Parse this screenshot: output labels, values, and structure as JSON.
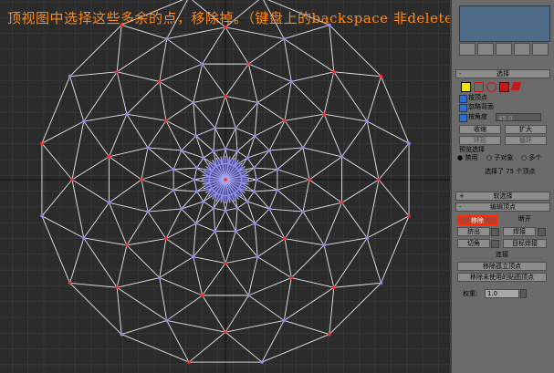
{
  "instruction": "顶视图中选择这些多余的点，移除掉。（键盘上的backspace 非delete）",
  "panel": {
    "selection_rollout": "选择",
    "sub_objects": [
      "顶点",
      "边",
      "边界",
      "多边形",
      "元素"
    ],
    "by_vertex": "按顶点",
    "ignore_backfacing": "忽略背面",
    "by_angle": "按角度",
    "by_angle_value": "45.0",
    "shrink": "收缩",
    "grow": "扩大",
    "ring": "环形",
    "loop": "循环",
    "preview_selection": "预览选择",
    "preview_options": [
      "禁用",
      "子对象",
      "多个"
    ],
    "selection_status": "选择了 75 个顶点",
    "soft_selection_rollout": "软选择",
    "edit_vertices_rollout": "编辑顶点",
    "remove": "移除",
    "break": "断开",
    "extrude": "挤出",
    "weld": "焊接",
    "chamfer": "切角",
    "target_weld": "目标焊接",
    "connect": "连接",
    "remove_isolated": "移除孤立顶点",
    "remove_unused_map": "移除未使用的贴图顶点",
    "weight_label": "权重:",
    "weight_value": "1.0"
  }
}
